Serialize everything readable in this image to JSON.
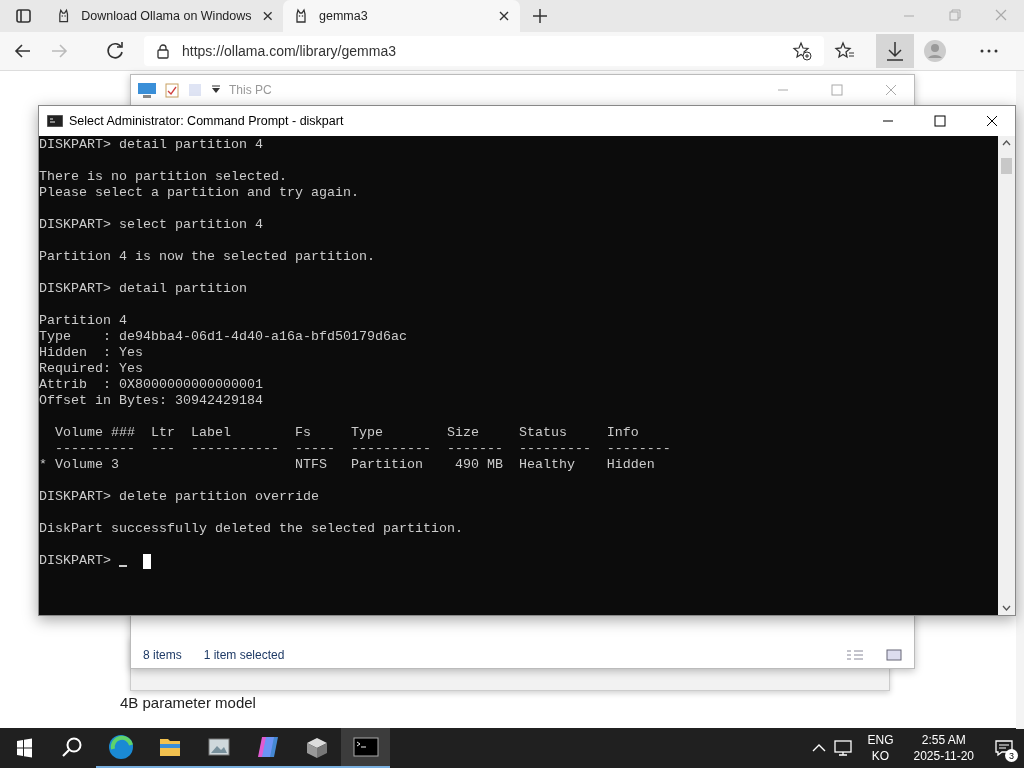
{
  "browser": {
    "tabs": [
      {
        "title": "Download Ollama on Windows",
        "selected": false
      },
      {
        "title": "gemma3",
        "selected": true
      }
    ],
    "address": "https://ollama.com/library/gemma3",
    "page_text": "4B parameter model"
  },
  "explorer": {
    "title": "This PC",
    "status_items": "8 items",
    "status_selected": "1 item selected"
  },
  "console": {
    "title": "Select Administrator: Command Prompt - diskpart",
    "blocks": [
      [
        "DISKPART> detail partition 4"
      ],
      [
        "There is no partition selected.",
        "Please select a partition and try again."
      ],
      [
        "DISKPART> select partition 4"
      ],
      [
        "Partition 4 is now the selected partition."
      ],
      [
        "DISKPART> detail partition"
      ],
      [
        "Partition 4",
        "Type    : de94bba4-06d1-4d40-a16a-bfd50179d6ac",
        "Hidden  : Yes",
        "Required: Yes",
        "Attrib  : 0X8000000000000001",
        "Offset in Bytes: 30942429184"
      ],
      [
        "  Volume ###  Ltr  Label        Fs     Type        Size     Status     Info",
        "  ----------  ---  -----------  -----  ----------  -------  ---------  --------",
        "* Volume 3                      NTFS   Partition    490 MB  Healthy    Hidden"
      ],
      [
        "DISKPART> delete partition override"
      ],
      [
        "DiskPart successfully deleted the selected partition."
      ]
    ],
    "prompt": "DISKPART>"
  },
  "taskbar": {
    "apps": [
      {
        "kind": "browser",
        "selected": false
      },
      {
        "kind": "folder",
        "selected": false
      },
      {
        "kind": "image",
        "selected": false
      },
      {
        "kind": "assistant",
        "selected": false
      },
      {
        "kind": "installer",
        "selected": false
      },
      {
        "kind": "terminal",
        "selected": true
      }
    ],
    "language": [
      "ENG",
      "KO"
    ],
    "time": "2:55 AM",
    "date": "2025-11-20",
    "notifications": "3"
  }
}
